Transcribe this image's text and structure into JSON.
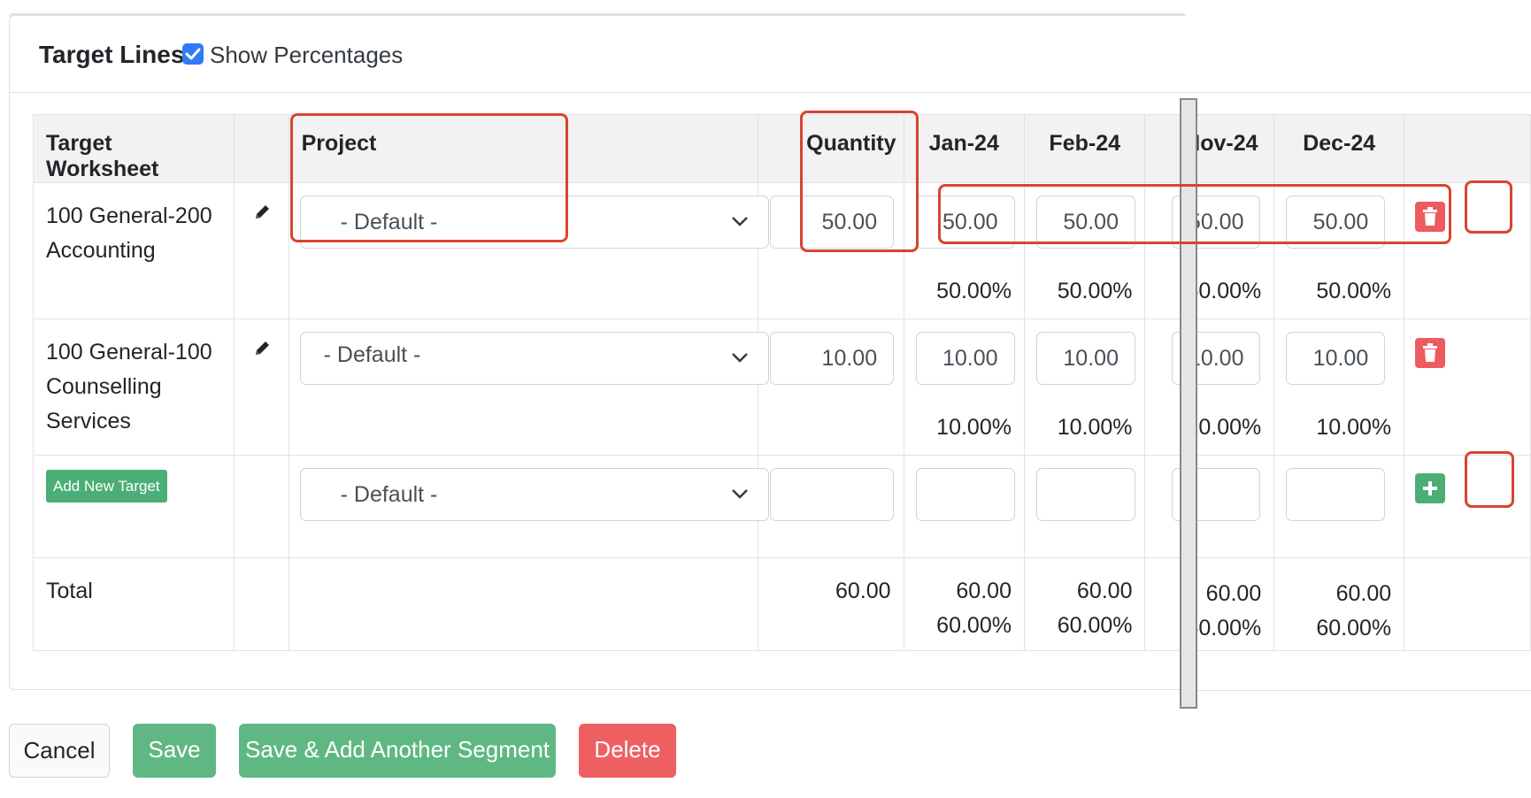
{
  "header": {
    "title": "Target Lines",
    "show_percentages_label": "Show Percentages",
    "show_percentages_checked": true
  },
  "table": {
    "columns": [
      "Target Worksheet",
      "",
      "Project",
      "Quantity",
      "Jan-24",
      "Feb-24",
      "Nov-24",
      "Dec-24",
      ""
    ],
    "rows": [
      {
        "worksheet": "100 General-200 Accounting",
        "project": "- Default -",
        "quantity": "50.00",
        "months": [
          "50.00",
          "50.00",
          "50.00",
          "50.00"
        ],
        "percents": [
          "50.00%",
          "50.00%",
          "50.00%",
          "50.00%"
        ]
      },
      {
        "worksheet": "100 General-100 Counselling Services",
        "project": "- Default -",
        "quantity": "10.00",
        "months": [
          "10.00",
          "10.00",
          "10.00",
          "10.00"
        ],
        "percents": [
          "10.00%",
          "10.00%",
          "10.00%",
          "10.00%"
        ]
      }
    ],
    "new_row": {
      "add_button": "Add New Target",
      "project": "- Default -"
    },
    "total": {
      "label": "Total",
      "quantity": "60.00",
      "months": [
        "60.00",
        "60.00",
        "60.00",
        "60.00"
      ],
      "percents": [
        "60.00%",
        "60.00%",
        "60.00%",
        "60.00%"
      ]
    }
  },
  "icons": {
    "edit": "pencil-icon",
    "delete": "trash-icon",
    "add": "plus-icon",
    "dropdown": "chevron-down-icon",
    "checkbox": "check-icon"
  },
  "colors": {
    "primary": "#2f7bf5",
    "success": "#4bae76",
    "danger": "#ed5b5f",
    "highlight": "#d9442f"
  },
  "footer": {
    "cancel": "Cancel",
    "save": "Save",
    "save_add": "Save & Add Another Segment",
    "delete": "Delete"
  }
}
